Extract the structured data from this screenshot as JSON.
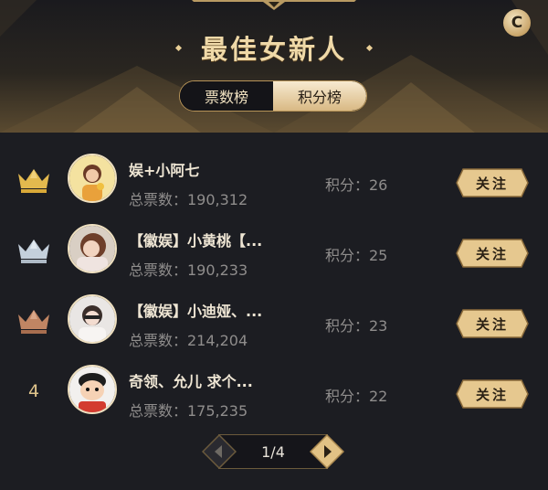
{
  "header": {
    "title": "最佳女新人",
    "refresh_icon_glyph": "C"
  },
  "tabs": [
    {
      "label": "票数榜",
      "active": true
    },
    {
      "label": "积分榜",
      "active": false
    }
  ],
  "entries": [
    {
      "rank": "1",
      "rank_badge": "gold-crown-icon",
      "name": "娱+小阿七",
      "votes": "总票数：190,312",
      "score": "积分：26",
      "follow_label": "关注"
    },
    {
      "rank": "2",
      "rank_badge": "silver-crown-icon",
      "name": "【徽娱】小黄桃【...",
      "votes": "总票数：190,233",
      "score": "积分：25",
      "follow_label": "关注"
    },
    {
      "rank": "3",
      "rank_badge": "bronze-crown-icon",
      "name": "【徽娱】小迪娅、...",
      "votes": "总票数：214,204",
      "score": "积分：23",
      "follow_label": "关注"
    },
    {
      "rank": "4",
      "rank_badge": "",
      "name": "奇领、允儿 求个...",
      "votes": "总票数：175,235",
      "score": "积分：22",
      "follow_label": "关注"
    }
  ],
  "pagination": {
    "label": "1/4",
    "current": 1,
    "total": 4
  },
  "colors": {
    "background": "#1c1d22",
    "gold_text": "#efd9a8",
    "gold_accent": "#c9a56a",
    "muted_text": "#8f8d8c",
    "crown_gold": "#e3b94e",
    "crown_silver": "#c4d0dc",
    "crown_bronze": "#c08563"
  }
}
